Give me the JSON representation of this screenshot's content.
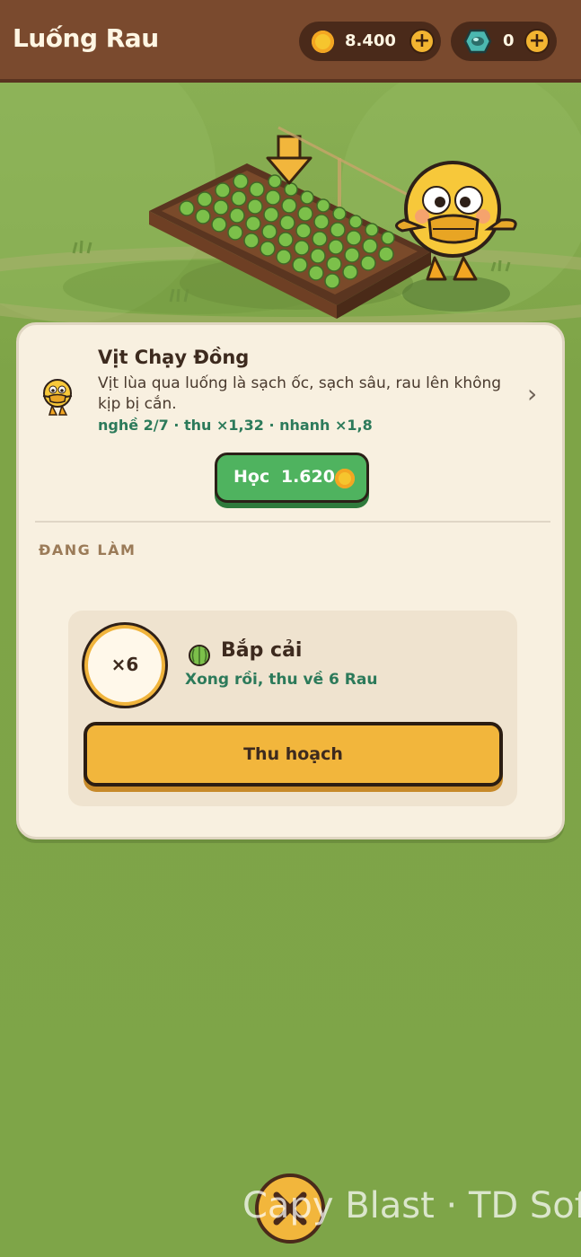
{
  "header": {
    "title": "Luống Rau",
    "coins": "8.400",
    "gems": "0"
  },
  "upgrade": {
    "name": "Vịt Chạy Đồng",
    "description": "Vịt lùa qua luống là sạch ốc, sạch sâu, rau lên không kịp bị cắn.",
    "stats": "nghề 2/7 · thu ×1,32 · nhanh ×1,8",
    "learn_label": "Học",
    "learn_cost": "1.620"
  },
  "section_title": "ĐANG LÀM",
  "job": {
    "multiplier": "×6",
    "crop_name": "Bắp cải",
    "status": "Xong rồi, thu về 6 Rau",
    "harvest_label": "Thu hoạch"
  },
  "watermark": "Capy Blast · TD Soft",
  "colors": {
    "header_bg": "#7a4a2e",
    "grass": "#80a44c",
    "card_bg": "#f8f0e0",
    "learn_button": "#4fb35f",
    "harvest_button": "#f2b63c",
    "stat_text": "#2c7a5a"
  },
  "icons": {
    "coin": "coin-icon",
    "gem": "gem-icon",
    "plus": "plus-icon",
    "chevron": "chevron-right-icon",
    "crop": "cabbage-icon",
    "close": "close-icon"
  }
}
